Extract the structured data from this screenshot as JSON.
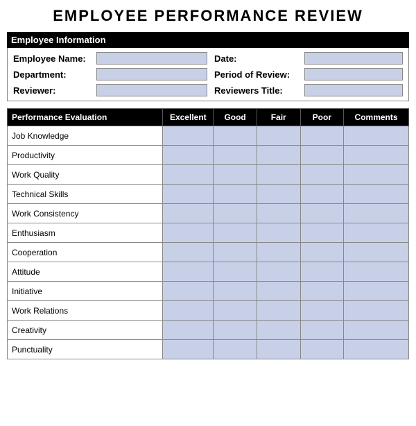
{
  "title": "EMPLOYEE  PERFORMANCE  REVIEW",
  "info_section_header": "Employee Information",
  "fields": {
    "employee_name_label": "Employee Name:",
    "date_label": "Date:",
    "department_label": "Department:",
    "period_label": "Period of Review:",
    "reviewer_label": "Reviewer:",
    "reviewer_title_label": "Reviewers Title:"
  },
  "table": {
    "headers": {
      "category": "Performance Evaluation",
      "excellent": "Excellent",
      "good": "Good",
      "fair": "Fair",
      "poor": "Poor",
      "comments": "Comments"
    },
    "rows": [
      "Job Knowledge",
      "Productivity",
      "Work Quality",
      "Technical Skills",
      "Work Consistency",
      "Enthusiasm",
      "Cooperation",
      "Attitude",
      "Initiative",
      "Work Relations",
      "Creativity",
      "Punctuality"
    ]
  }
}
